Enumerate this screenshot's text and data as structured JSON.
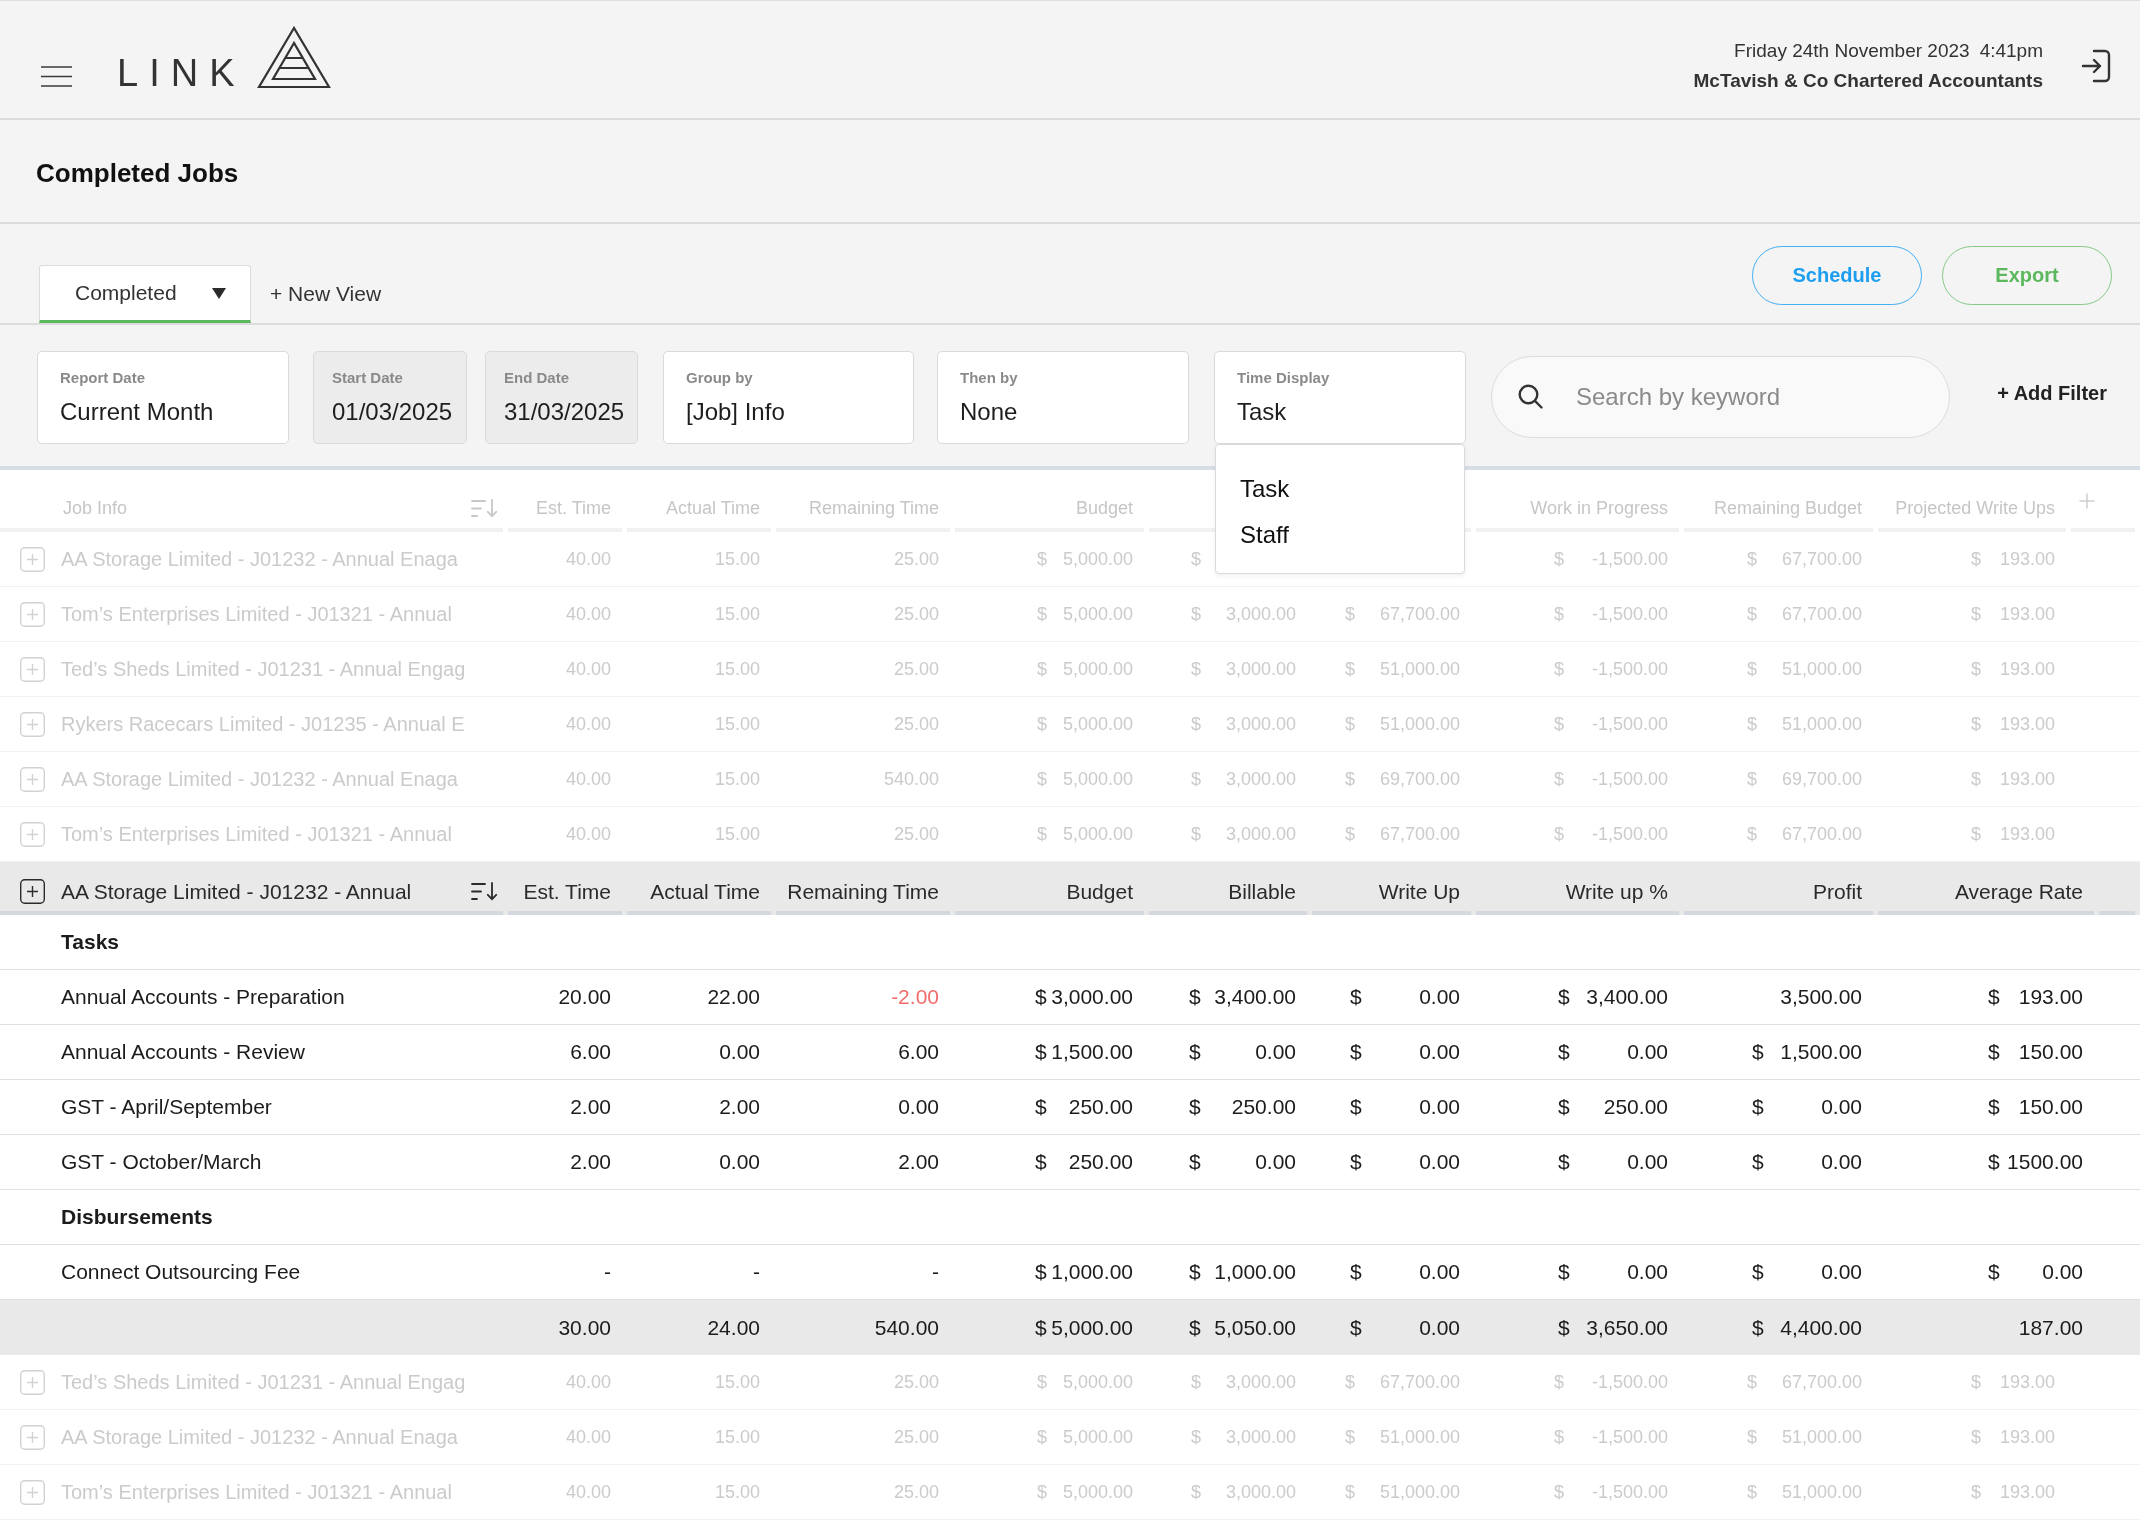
{
  "header": {
    "logo_text": "LINK",
    "date": "Friday 24th November 2023",
    "time": "4:41pm",
    "company": "McTavish & Co Chartered Accountants"
  },
  "page_title": "Completed Jobs",
  "views": {
    "tabs": [
      {
        "label": "Completed",
        "selected": true
      }
    ],
    "new_view": "+ New View"
  },
  "actions": [
    {
      "label": "Schedule",
      "kind": "info"
    },
    {
      "label": "Export",
      "kind": "success"
    }
  ],
  "filters": [
    {
      "label": "Report Date",
      "value": "Current Month",
      "disabled": false,
      "expanded": false
    },
    {
      "label": "Start Date",
      "value": "01/03/2025",
      "disabled": true,
      "expanded": false
    },
    {
      "label": "End Date",
      "value": "31/03/2025",
      "disabled": true,
      "expanded": false
    },
    {
      "label": "Group by",
      "value": "[Job] Info",
      "disabled": false,
      "expanded": false
    },
    {
      "label": "Then by",
      "value": "None",
      "disabled": false,
      "expanded": false
    },
    {
      "label": "Time Display",
      "value": "Task",
      "disabled": false,
      "expanded": true,
      "options": [
        "Task",
        "Staff"
      ]
    }
  ],
  "search": {
    "placeholder": "Search by keyword"
  },
  "add_filter": "+ Add Filter",
  "table": {
    "columns": [
      "Job Info",
      "Est. Time",
      "Actual Time",
      "Remaining Time",
      "Budget",
      null,
      null,
      "Work in Progress",
      "Remaining Budget",
      "Projected Write Ups"
    ],
    "jobs": [
      {
        "name": "AA Storage Limited - J01232 - Annual Enaga",
        "expanded": false,
        "cells": [
          "40.00",
          "15.00",
          "25.00",
          {
            "currency": "$",
            "amount": "5,000.00"
          },
          {
            "currency": "$"
          },
          null,
          {
            "currency": "$",
            "amount": "-1,500.00"
          },
          {
            "currency": "$",
            "amount": "67,700.00"
          },
          {
            "currency": "$",
            "amount": "193.00"
          }
        ]
      },
      {
        "name": "Tom’s Enterprises Limited - J01321 - Annual",
        "expanded": false,
        "cells": [
          "40.00",
          "15.00",
          "25.00",
          {
            "currency": "$",
            "amount": "5,000.00"
          },
          {
            "currency": "$",
            "amount": "3,000.00"
          },
          {
            "currency": "$",
            "amount": "67,700.00"
          },
          {
            "currency": "$",
            "amount": "-1,500.00"
          },
          {
            "currency": "$",
            "amount": "67,700.00"
          },
          {
            "currency": "$",
            "amount": "193.00"
          }
        ]
      },
      {
        "name": "Ted’s Sheds Limited - J01231 - Annual Engag",
        "expanded": false,
        "cells": [
          "40.00",
          "15.00",
          "25.00",
          {
            "currency": "$",
            "amount": "5,000.00"
          },
          {
            "currency": "$",
            "amount": "3,000.00"
          },
          {
            "currency": "$",
            "amount": "51,000.00"
          },
          {
            "currency": "$",
            "amount": "-1,500.00"
          },
          {
            "currency": "$",
            "amount": "51,000.00"
          },
          {
            "currency": "$",
            "amount": "193.00"
          }
        ]
      },
      {
        "name": "Rykers Racecars Limited - J01235 - Annual E",
        "expanded": false,
        "cells": [
          "40.00",
          "15.00",
          "25.00",
          {
            "currency": "$",
            "amount": "5,000.00"
          },
          {
            "currency": "$",
            "amount": "3,000.00"
          },
          {
            "currency": "$",
            "amount": "51,000.00"
          },
          {
            "currency": "$",
            "amount": "-1,500.00"
          },
          {
            "currency": "$",
            "amount": "51,000.00"
          },
          {
            "currency": "$",
            "amount": "193.00"
          }
        ]
      },
      {
        "name": "AA Storage Limited - J01232 - Annual Enaga",
        "expanded": false,
        "cells": [
          "40.00",
          "15.00",
          "540.00",
          {
            "currency": "$",
            "amount": "5,000.00"
          },
          {
            "currency": "$",
            "amount": "3,000.00"
          },
          {
            "currency": "$",
            "amount": "69,700.00"
          },
          {
            "currency": "$",
            "amount": "-1,500.00"
          },
          {
            "currency": "$",
            "amount": "69,700.00"
          },
          {
            "currency": "$",
            "amount": "193.00"
          }
        ]
      },
      {
        "name": "Tom’s Enterprises Limited - J01321 - Annual",
        "expanded": false,
        "cells": [
          "40.00",
          "15.00",
          "25.00",
          {
            "currency": "$",
            "amount": "5,000.00"
          },
          {
            "currency": "$",
            "amount": "3,000.00"
          },
          {
            "currency": "$",
            "amount": "67,700.00"
          },
          {
            "currency": "$",
            "amount": "-1,500.00"
          },
          {
            "currency": "$",
            "amount": "67,700.00"
          },
          {
            "currency": "$",
            "amount": "193.00"
          }
        ]
      },
      {
        "name": "AA Storage Limited - J01232 - Annual",
        "expanded": true,
        "columns": [
          "Est. Time",
          "Actual Time",
          "Remaining Time",
          "Budget",
          "Billable",
          "Write Up",
          "Write up %",
          "Profit",
          "Average Rate"
        ],
        "sections": [
          {
            "title": "Tasks",
            "rows": [
              {
                "name": "Annual Accounts - Preparation",
                "cells": [
                  "20.00",
                  "22.00",
                  {
                    "value": "-2.00",
                    "negative": true
                  },
                  {
                    "currency": "$",
                    "amount": "3,000.00"
                  },
                  {
                    "currency": "$",
                    "amount": "3,400.00"
                  },
                  {
                    "currency": "$",
                    "amount": "0.00"
                  },
                  {
                    "currency": "$",
                    "amount": "3,400.00"
                  },
                  "3,500.00",
                  {
                    "currency": "$",
                    "amount": "193.00"
                  }
                ]
              },
              {
                "name": "Annual Accounts - Review",
                "cells": [
                  "6.00",
                  "0.00",
                  "6.00",
                  {
                    "currency": "$",
                    "amount": "1,500.00"
                  },
                  {
                    "currency": "$",
                    "amount": "0.00"
                  },
                  {
                    "currency": "$",
                    "amount": "0.00"
                  },
                  {
                    "currency": "$",
                    "amount": "0.00"
                  },
                  {
                    "currency": "$",
                    "amount": "1,500.00"
                  },
                  {
                    "currency": "$",
                    "amount": "150.00"
                  }
                ]
              },
              {
                "name": "GST - April/September",
                "cells": [
                  "2.00",
                  "2.00",
                  "0.00",
                  {
                    "currency": "$",
                    "amount": "250.00"
                  },
                  {
                    "currency": "$",
                    "amount": "250.00"
                  },
                  {
                    "currency": "$",
                    "amount": "0.00"
                  },
                  {
                    "currency": "$",
                    "amount": "250.00"
                  },
                  {
                    "currency": "$",
                    "amount": "0.00"
                  },
                  {
                    "currency": "$",
                    "amount": "150.00"
                  }
                ]
              },
              {
                "name": "GST - October/March",
                "cells": [
                  "2.00",
                  "0.00",
                  "2.00",
                  {
                    "currency": "$",
                    "amount": "250.00"
                  },
                  {
                    "currency": "$",
                    "amount": "0.00"
                  },
                  {
                    "currency": "$",
                    "amount": "0.00"
                  },
                  {
                    "currency": "$",
                    "amount": "0.00"
                  },
                  {
                    "currency": "$",
                    "amount": "0.00"
                  },
                  {
                    "currency": "$",
                    "amount": "1500.00"
                  }
                ]
              }
            ]
          },
          {
            "title": "Disbursements",
            "rows": [
              {
                "name": "Connect Outsourcing Fee",
                "cells": [
                  "-",
                  "-",
                  "-",
                  {
                    "currency": "$",
                    "amount": "1,000.00"
                  },
                  {
                    "currency": "$",
                    "amount": "1,000.00"
                  },
                  {
                    "currency": "$",
                    "amount": "0.00"
                  },
                  {
                    "currency": "$",
                    "amount": "0.00"
                  },
                  {
                    "currency": "$",
                    "amount": "0.00"
                  },
                  {
                    "currency": "$",
                    "amount": "0.00"
                  }
                ]
              }
            ]
          }
        ],
        "totals": [
          "30.00",
          "24.00",
          "540.00",
          {
            "currency": "$",
            "amount": "5,000.00"
          },
          {
            "currency": "$",
            "amount": "5,050.00"
          },
          {
            "currency": "$",
            "amount": "0.00"
          },
          {
            "currency": "$",
            "amount": "3,650.00"
          },
          {
            "currency": "$",
            "amount": "4,400.00"
          },
          "187.00"
        ]
      },
      {
        "name": "Ted’s Sheds Limited - J01231 - Annual Engag",
        "expanded": false,
        "cells": [
          "40.00",
          "15.00",
          "25.00",
          {
            "currency": "$",
            "amount": "5,000.00"
          },
          {
            "currency": "$",
            "amount": "3,000.00"
          },
          {
            "currency": "$",
            "amount": "67,700.00"
          },
          {
            "currency": "$",
            "amount": "-1,500.00"
          },
          {
            "currency": "$",
            "amount": "67,700.00"
          },
          {
            "currency": "$",
            "amount": "193.00"
          }
        ]
      },
      {
        "name": "AA Storage Limited - J01232 - Annual Enaga",
        "expanded": false,
        "cells": [
          "40.00",
          "15.00",
          "25.00",
          {
            "currency": "$",
            "amount": "5,000.00"
          },
          {
            "currency": "$",
            "amount": "3,000.00"
          },
          {
            "currency": "$",
            "amount": "51,000.00"
          },
          {
            "currency": "$",
            "amount": "-1,500.00"
          },
          {
            "currency": "$",
            "amount": "51,000.00"
          },
          {
            "currency": "$",
            "amount": "193.00"
          }
        ]
      },
      {
        "name": "Tom’s Enterprises Limited - J01321 - Annual",
        "expanded": false,
        "cells": [
          "40.00",
          "15.00",
          "25.00",
          {
            "currency": "$",
            "amount": "5,000.00"
          },
          {
            "currency": "$",
            "amount": "3,000.00"
          },
          {
            "currency": "$",
            "amount": "51,000.00"
          },
          {
            "currency": "$",
            "amount": "-1,500.00"
          },
          {
            "currency": "$",
            "amount": "51,000.00"
          },
          {
            "currency": "$",
            "amount": "193.00"
          }
        ]
      }
    ]
  }
}
